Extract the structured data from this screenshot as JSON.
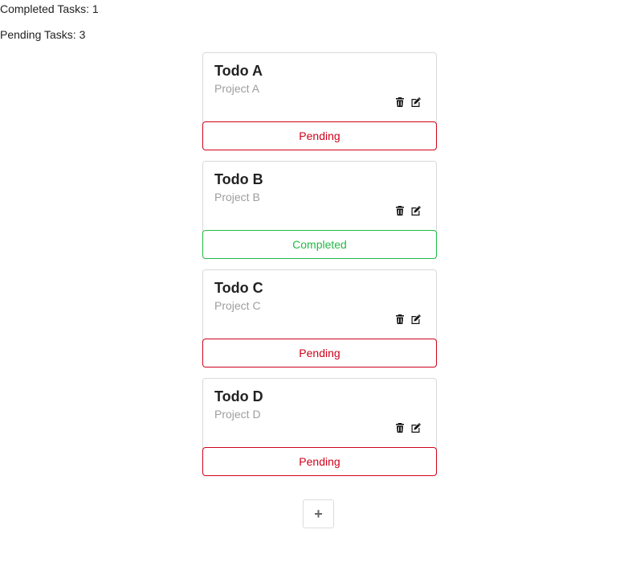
{
  "stats": {
    "completed": "Completed Tasks: 1",
    "pending": "Pending Tasks: 3"
  },
  "todos": [
    {
      "title": "Todo A",
      "project": "Project A",
      "status": "Pending"
    },
    {
      "title": "Todo B",
      "project": "Project B",
      "status": "Completed"
    },
    {
      "title": "Todo C",
      "project": "Project C",
      "status": "Pending"
    },
    {
      "title": "Todo D",
      "project": "Project D",
      "status": "Pending"
    }
  ],
  "icons": {
    "delete": "trash-icon",
    "edit": "edit-icon",
    "add": "plus-icon"
  },
  "add_button": {
    "label": "+"
  },
  "colors": {
    "pending": "#d0021b",
    "completed": "#21ba45"
  }
}
